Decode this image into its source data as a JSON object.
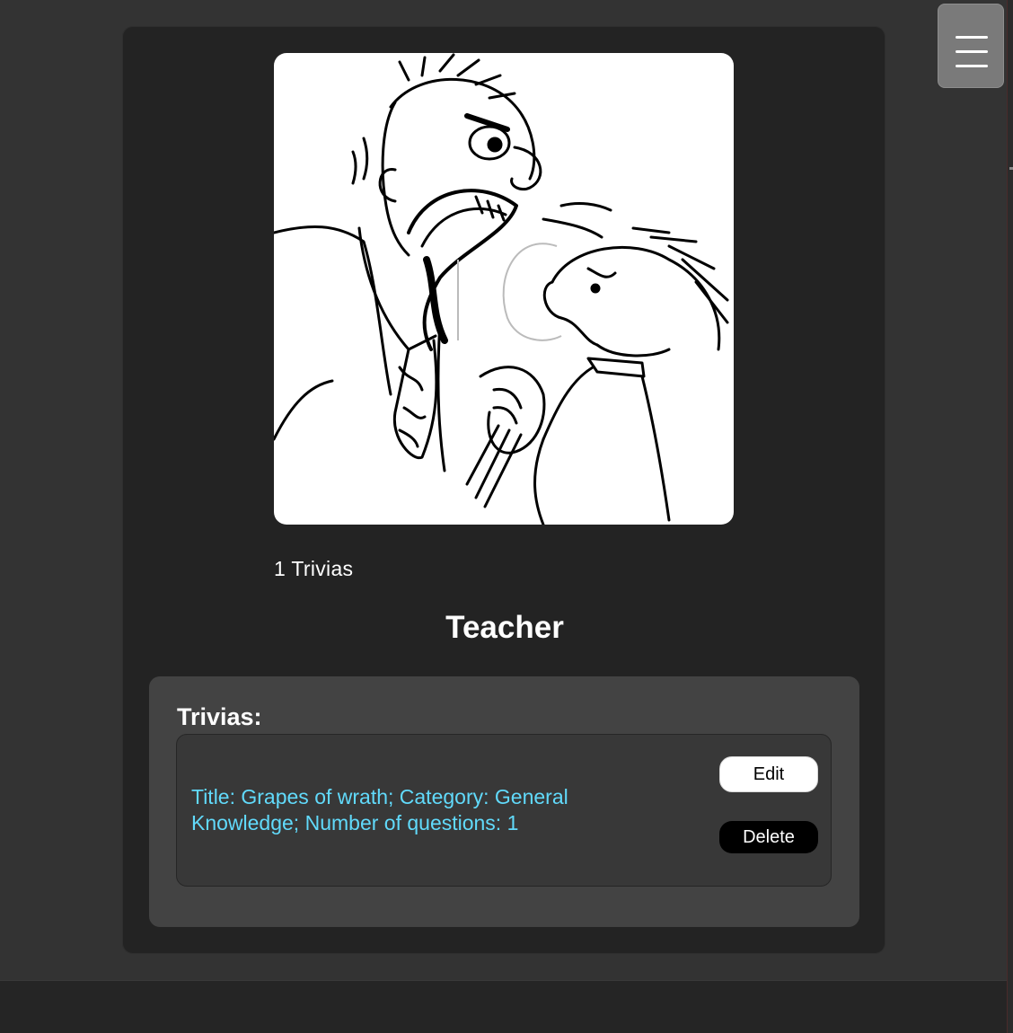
{
  "menu": {
    "icon": "hamburger-menu-icon"
  },
  "profile": {
    "avatar_description_icon": "cartoon-avatar-image",
    "trivia_count_text": "1 Trivias",
    "username": "Teacher"
  },
  "trivias": {
    "heading": "Trivias:",
    "items": [
      {
        "summary": "Title: Grapes of wrath; Category: General Knowledge; Number of questions: 1",
        "edit_label": "Edit",
        "delete_label": "Delete"
      }
    ]
  },
  "colors": {
    "page_background": "#333333",
    "card_background": "#232323",
    "panel_background": "#434343",
    "item_background": "#383838",
    "link_text": "#61dafb"
  }
}
